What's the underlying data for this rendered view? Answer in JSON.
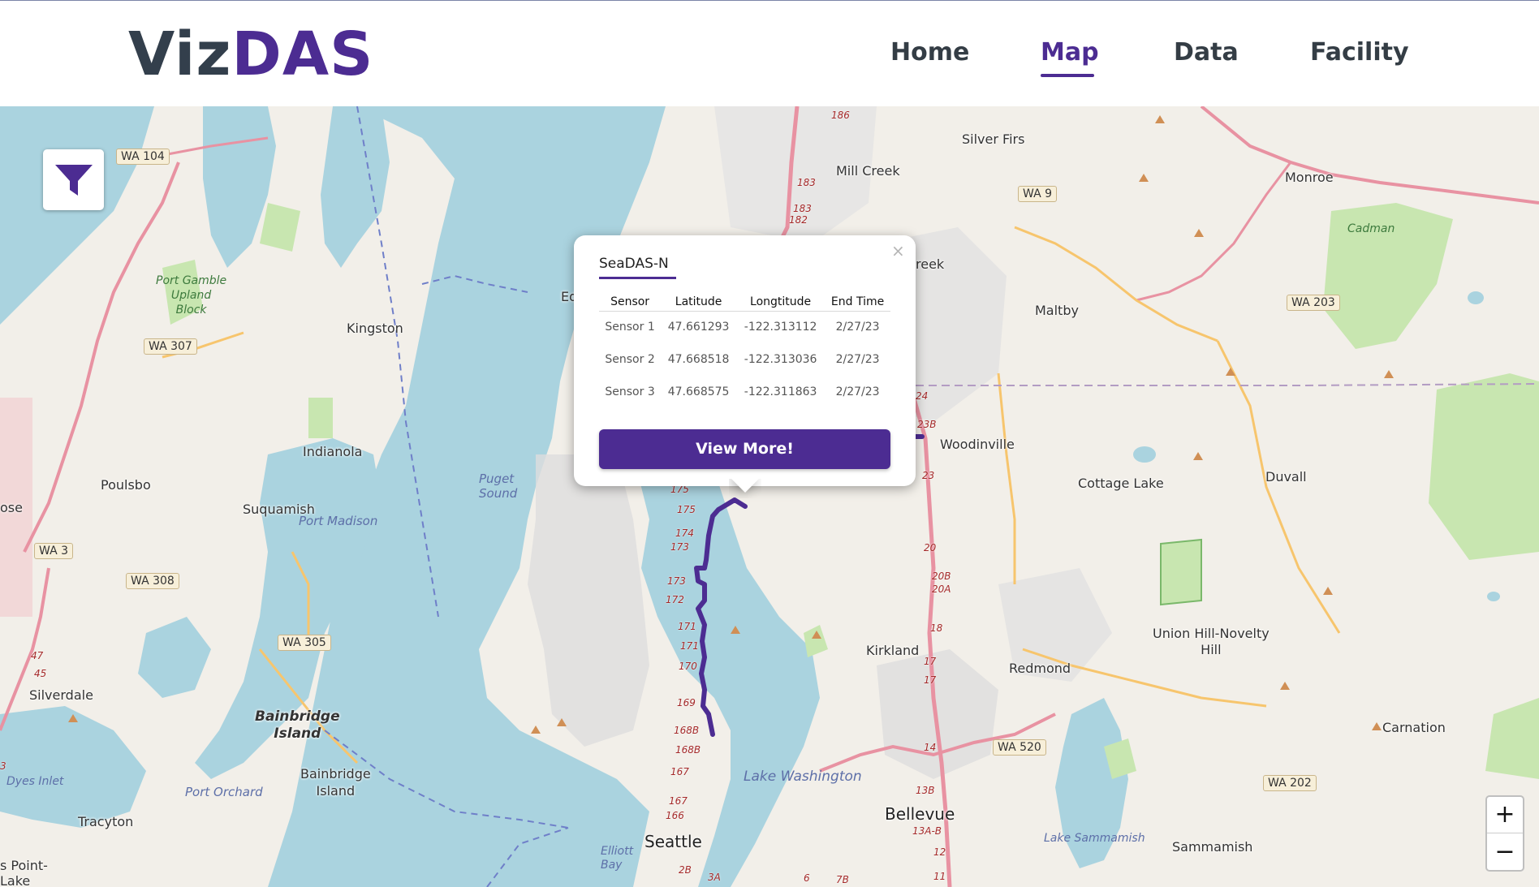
{
  "app": {
    "logo_part1": "Viz",
    "logo_part2": "DAS"
  },
  "nav": {
    "items": [
      {
        "label": "Home",
        "active": false
      },
      {
        "label": "Map",
        "active": true
      },
      {
        "label": "Data",
        "active": false
      },
      {
        "label": "Facility",
        "active": false
      }
    ]
  },
  "colors": {
    "brand": "#4c2c92",
    "logo_dark": "#333f4c",
    "water": "#aad3df",
    "land": "#f2efe9",
    "park": "#c8e6b0",
    "motorway": "#e892a2",
    "route": "#4c2c92"
  },
  "map": {
    "filter_icon": "filter-icon",
    "zoom_in": "+",
    "zoom_out": "−",
    "places": {
      "silver_firs": "Silver Firs",
      "mill_creek": "Mill Creek",
      "monroe": "Monroe",
      "maltby": "Maltby",
      "woodinville": "Woodinville",
      "cottage_lake": "Cottage Lake",
      "duvall": "Duvall",
      "kingston": "Kingston",
      "indianola": "Indianola",
      "poulsbo": "Poulsbo",
      "suquamish": "Suquamish",
      "silverdale": "Silverdale",
      "bainbridge_island_area": "Bainbridge\nIsland",
      "bainbridge_island_town": "Bainbridge\nIsland",
      "tracyton": "Tracyton",
      "seattle": "Seattle",
      "kirkland": "Kirkland",
      "redmond": "Redmond",
      "union_hill": "Union Hill-Novelty\nHill",
      "carnation": "Carnation",
      "bellevue": "Bellevue",
      "sammamish": "Sammamish",
      "creek_partial": "reek",
      "ed_partial": "Ed",
      "ose_partial": "ose",
      "points_partial": "s Point-\nLake"
    },
    "water_labels": {
      "puget_sound": "Puget\nSound",
      "port_madison": "Port Madison",
      "lake_washington": "Lake Washington",
      "port_orchard": "Port Orchard",
      "dyes_inlet": "Dyes Inlet",
      "elliott_bay": "Elliott\nBay",
      "lake_sammamish": "Lake Sammamish"
    },
    "park_labels": {
      "port_gamble": "Port Gamble\nUpland\nBlock",
      "cadman": "Cadman"
    },
    "shields": {
      "wa104": "WA 104",
      "wa9": "WA 9",
      "wa203": "WA 203",
      "wa307": "WA 307",
      "wa3": "WA 3",
      "wa308": "WA 308",
      "wa305": "WA 305",
      "wa520": "WA 520",
      "wa202": "WA 202"
    },
    "exits": [
      "186",
      "183",
      "183",
      "182",
      "175",
      "175",
      "174",
      "173",
      "173",
      "172",
      "171",
      "171",
      "170",
      "169",
      "168B",
      "168B",
      "167",
      "167",
      "166",
      "2B",
      "3A",
      "7B",
      "6",
      "24",
      "23B",
      "23",
      "20",
      "20B",
      "20A",
      "18",
      "17",
      "17",
      "14",
      "13B",
      "13A-B",
      "12",
      "11",
      "47",
      "45",
      "3"
    ]
  },
  "popup": {
    "close": "×",
    "title": "SeaDAS-N",
    "columns": [
      "Sensor",
      "Latitude",
      "Longtitude",
      "End Time"
    ],
    "rows": [
      [
        "Sensor 1",
        "47.661293",
        "-122.313112",
        "2/27/23"
      ],
      [
        "Sensor 2",
        "47.668518",
        "-122.313036",
        "2/27/23"
      ],
      [
        "Sensor 3",
        "47.668575",
        "-122.311863",
        "2/27/23"
      ]
    ],
    "button": "View More!"
  }
}
